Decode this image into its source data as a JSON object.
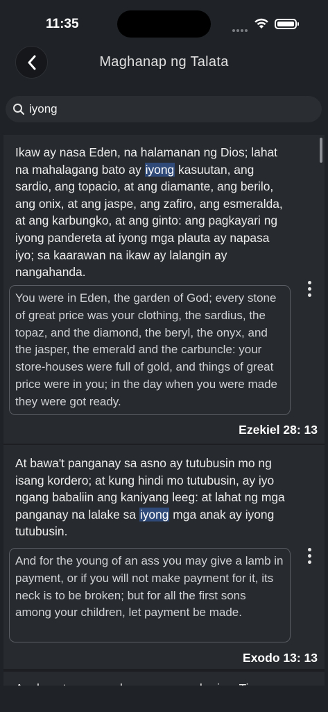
{
  "status": {
    "time": "11:35"
  },
  "header": {
    "title": "Maghanap ng Talata"
  },
  "search": {
    "value": "iyong",
    "placeholder": ""
  },
  "results": [
    {
      "tl_before": "Ikaw ay nasa Eden, na halamanan ng Dios; lahat na mahalagang bato ay ",
      "tl_highlight": "iyong",
      "tl_after": " kasuutan, ang sardio, ang topacio, at ang diamante, ang berilo, ang onix, at ang jaspe, ang zafiro, ang esmeralda, at ang karbungko, at ang ginto: ang pagkayari ng iyong pandereta at iyong mga plauta ay napasa iyo; sa kaarawan na ikaw ay lalangin ay nangahanda.",
      "en": "You were in Eden, the garden of God; every stone of great price was your clothing, the sardius, the topaz, and the diamond, the beryl, the onyx, and the jasper, the emerald and the carbuncle: your store-houses were full of gold, and things of great price were in you; in the day when you were made they were got ready.",
      "reference": "Ezekiel 28: 13"
    },
    {
      "tl_before": "At bawa't panganay sa asno ay tutubusin mo ng isang kordero; at kung hindi mo tutubusin, ay iyo ngang babaliin ang kaniyang leeg: at lahat ng mga panganay na lalake sa ",
      "tl_highlight": "iyong",
      "tl_after": " mga anak ay iyong tutubusin.",
      "en": "And for the young of an ass you may give a lamb in payment, or if you will not make payment for it, its neck is to be broken; but for all the first sons among your children, let payment be made.",
      "reference": "Exodo 13: 13"
    },
    {
      "tl_before": "Anak ng tao, panaghuyan mo ang hari sa Tiro"
    }
  ]
}
